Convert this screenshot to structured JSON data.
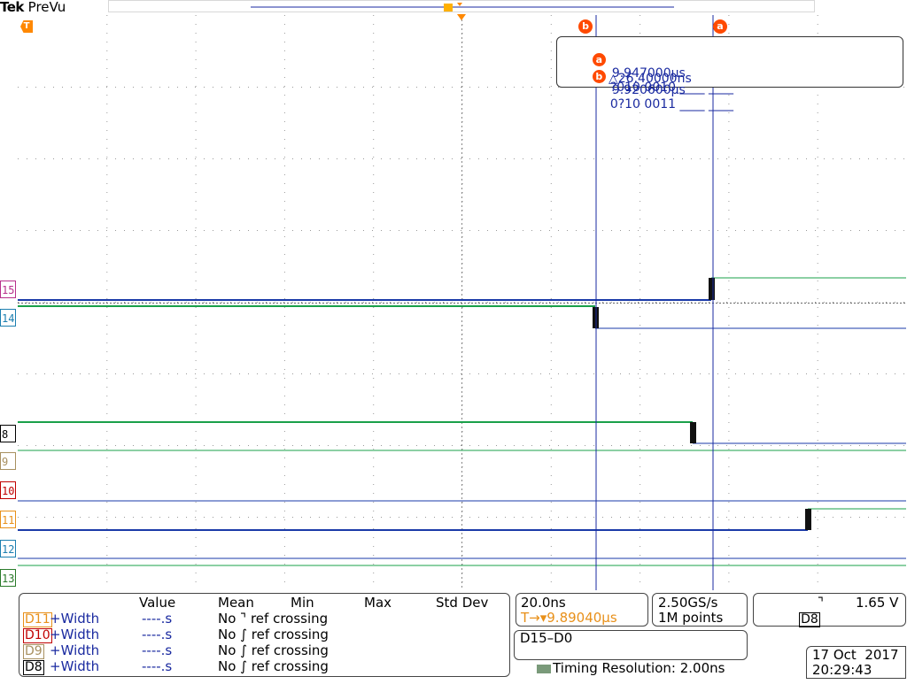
{
  "brand": {
    "vendor": "Tek",
    "mode": "PreVu"
  },
  "trigger_marker": "T",
  "record_marker": "T",
  "channels": [
    {
      "label": "15",
      "color": "#b8308c"
    },
    {
      "label": "14",
      "color": "#1c7fb0"
    },
    {
      "label": "8",
      "color": "#000000"
    },
    {
      "label": "9",
      "color": "#a89060"
    },
    {
      "label": "10",
      "color": "#c00000"
    },
    {
      "label": "11",
      "color": "#e8901a"
    },
    {
      "label": "12",
      "color": "#1c7fb0"
    },
    {
      "label": "13",
      "color": "#2a7a2a"
    }
  ],
  "cursor_labels": {
    "a": "a",
    "b": "b"
  },
  "cursor_readout": {
    "a": {
      "badge": "a",
      "time": "9.947000µs",
      "bits": "?010 0010 ____ ____"
    },
    "b": {
      "badge": "b",
      "time": "9.920600µs",
      "bits": "0?10 0011 ____ ____"
    },
    "delta": "△26.40000ns"
  },
  "measurements": {
    "headers": [
      "Value",
      "Mean",
      "Min",
      "Max",
      "Std Dev"
    ],
    "rows": [
      {
        "source": "D11",
        "source_color": "#e8901a",
        "type": "+Width",
        "value": "----.s",
        "note": "No ⌝ ref crossing"
      },
      {
        "source": "D10",
        "source_color": "#c00000",
        "type": "+Width",
        "value": "----.s",
        "note": "No ∫ ref crossing"
      },
      {
        "source": "D9",
        "source_color": "#a89060",
        "type": "+Width",
        "value": "----.s",
        "note": "No ∫ ref crossing"
      },
      {
        "source": "D8",
        "source_color": "#000000",
        "type": "+Width",
        "value": "----.s",
        "note": "No ∫ ref crossing"
      }
    ]
  },
  "horizontal": {
    "scale": "20.0ns",
    "trigger_pos": "T→▾9.89040µs"
  },
  "acquisition": {
    "rate": "2.50GS/s",
    "points": "1M points"
  },
  "trigger": {
    "source": "D8",
    "slope": "⌝",
    "level": "1.65 V"
  },
  "timing": {
    "channels": "D15–D0",
    "resolution": "Timing Resolution: 2.00ns"
  },
  "datetime": {
    "date": "17 Oct  2017",
    "time": "20:29:43"
  }
}
